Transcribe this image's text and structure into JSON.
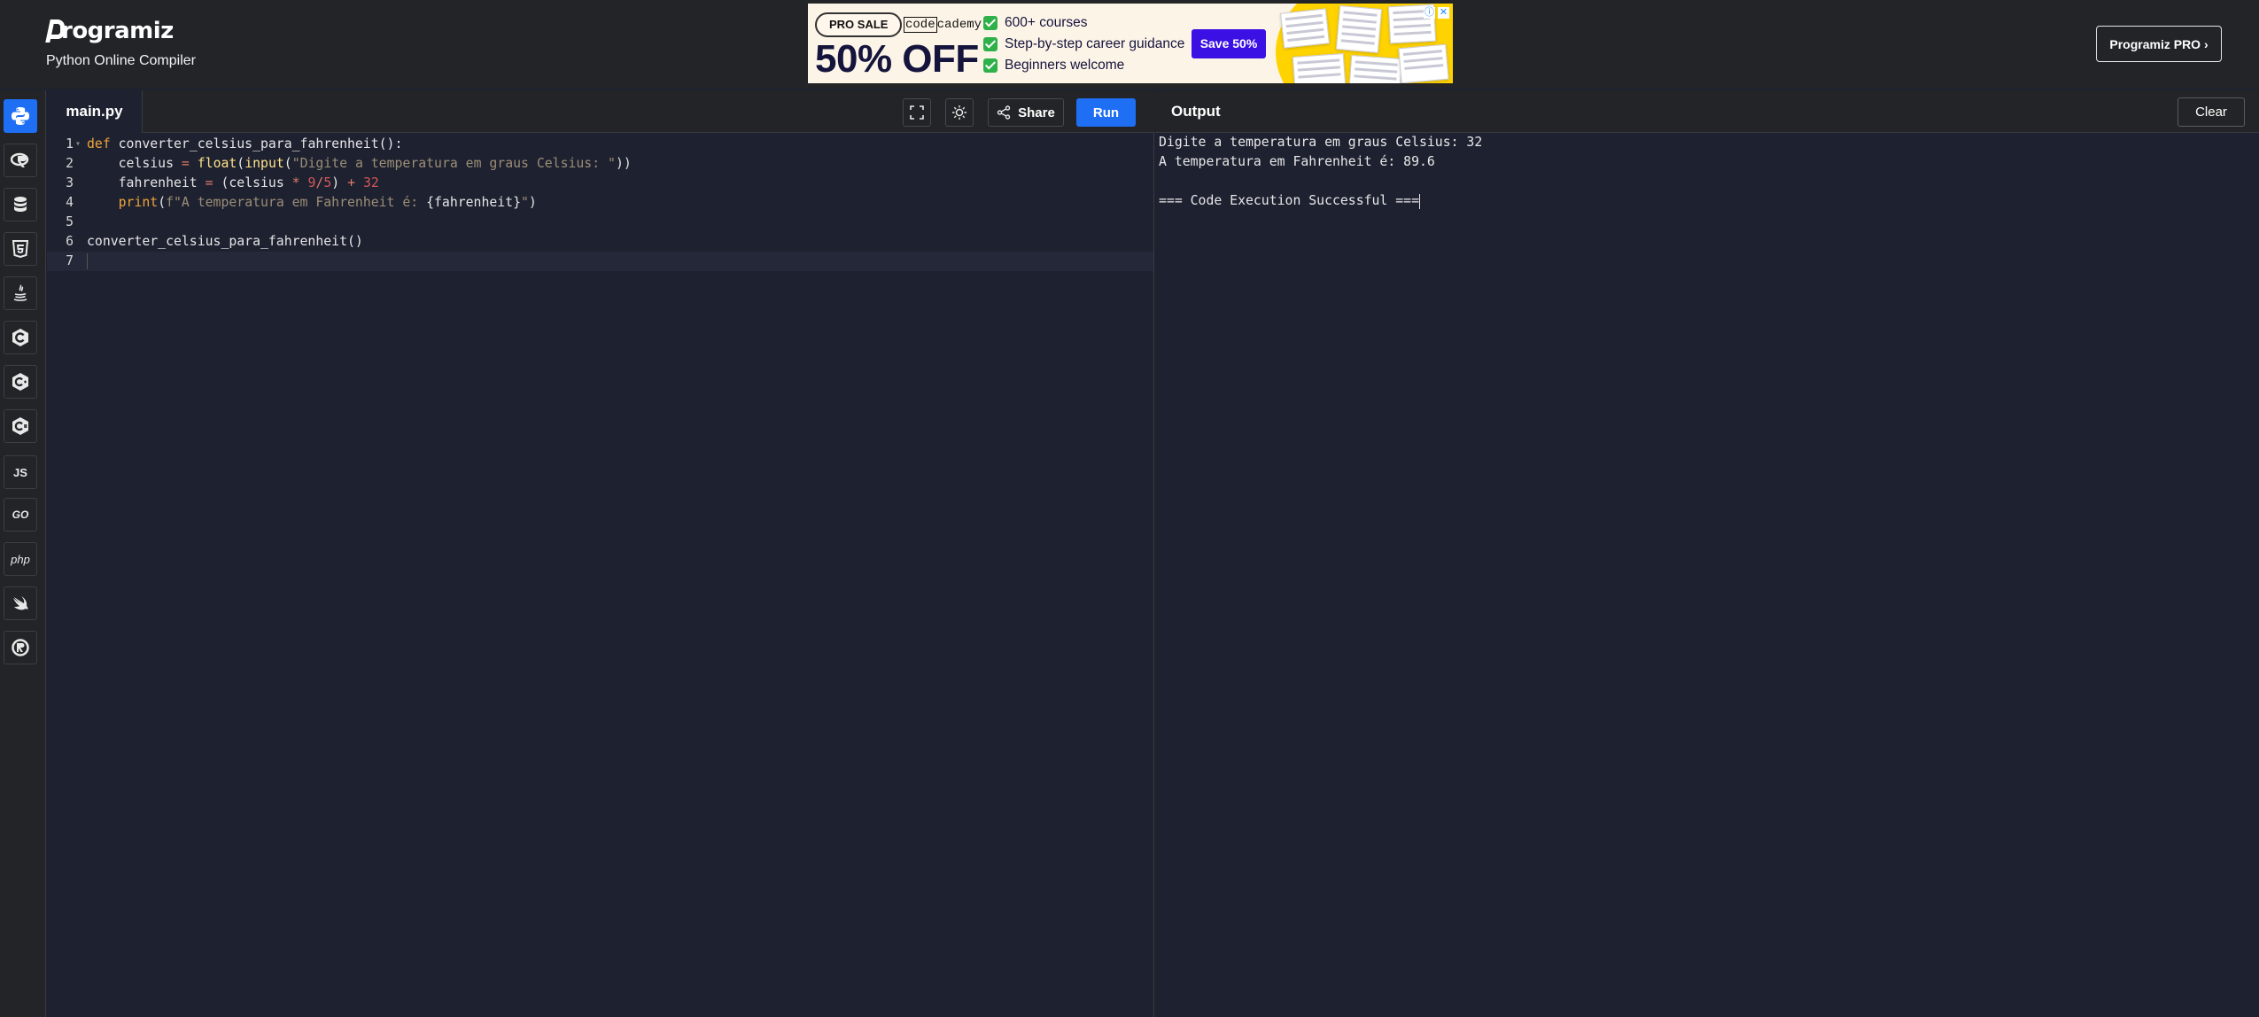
{
  "header": {
    "logo_text": "rogramiz",
    "subtitle": "Python Online Compiler",
    "pro_button": "Programiz PRO ›"
  },
  "ad": {
    "badge": "PRO SALE",
    "brand_boxed": "code",
    "brand_rest": "cademy",
    "headline": "50% OFF",
    "bullets": [
      "600+ courses",
      "Step-by-step career guidance",
      "Beginners welcome"
    ],
    "cta": "Save 50%",
    "info_icon": "ⓘ",
    "close_icon": "✕"
  },
  "sidebar": {
    "languages": [
      {
        "name": "python",
        "label": ""
      },
      {
        "name": "r",
        "label": ""
      },
      {
        "name": "sql",
        "label": ""
      },
      {
        "name": "html",
        "label": ""
      },
      {
        "name": "java",
        "label": ""
      },
      {
        "name": "c",
        "label": ""
      },
      {
        "name": "cpp",
        "label": ""
      },
      {
        "name": "csharp",
        "label": ""
      },
      {
        "name": "js",
        "label": "JS"
      },
      {
        "name": "go",
        "label": "GO"
      },
      {
        "name": "php",
        "label": "php"
      },
      {
        "name": "swift",
        "label": ""
      },
      {
        "name": "rust",
        "label": ""
      }
    ]
  },
  "editor": {
    "file_tab": "main.py",
    "share_label": "Share",
    "run_label": "Run",
    "line_numbers": [
      "1",
      "2",
      "3",
      "4",
      "5",
      "6",
      "7"
    ],
    "code": {
      "l1_kw": "def",
      "l1_rest": " converter_celsius_para_fahrenheit():",
      "l2_indent": "    celsius ",
      "l2_eq": "=",
      "l2_sp": " ",
      "l2_float": "float",
      "l2_p1": "(",
      "l2_input": "input",
      "l2_p2": "(",
      "l2_str": "\"Digite a temperatura em graus Celsius: \"",
      "l2_close": "))",
      "l3_indent": "    fahrenheit ",
      "l3_eq": "=",
      "l3_a": " (celsius ",
      "l3_mul": "*",
      "l3_sp": " ",
      "l3_9": "9",
      "l3_div": "/",
      "l3_5": "5",
      "l3_b": ") ",
      "l3_plus": "+",
      "l3_sp2": " ",
      "l3_32": "32",
      "l4_indent": "    ",
      "l4_print": "print",
      "l4_p": "(",
      "l4_str": "f\"A temperatura em Fahrenheit é: ",
      "l4_expr": "{fahrenheit}",
      "l4_str2": "\"",
      "l4_close": ")",
      "l6": "converter_celsius_para_fahrenheit()"
    }
  },
  "output": {
    "title": "Output",
    "clear_label": "Clear",
    "lines": [
      "Digite a temperatura em graus Celsius: 32",
      "A temperatura em Fahrenheit é: 89.6",
      "",
      "=== Code Execution Successful ==="
    ]
  },
  "colors": {
    "accent": "#1f6ff5",
    "background": "#1e2130",
    "header": "#232427",
    "keyword": "#f0a43a",
    "string": "#9c8e77"
  }
}
